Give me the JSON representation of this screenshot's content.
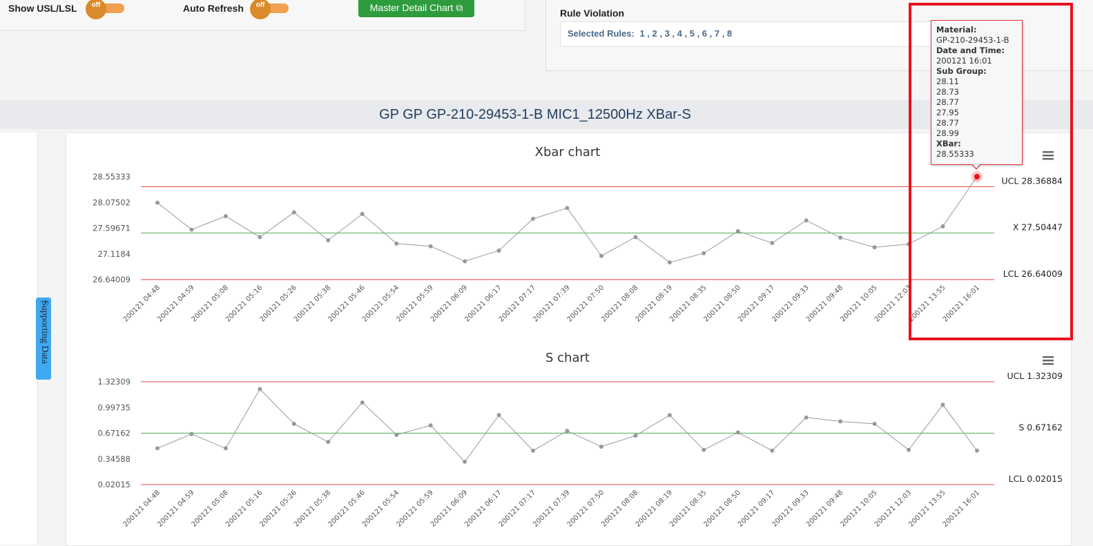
{
  "toolbar": {
    "show_usl_lsl_label": "Show USL/LSL",
    "show_usl_lsl_state": "off",
    "auto_refresh_label": "Auto Refresh",
    "auto_refresh_state": "off",
    "master_detail_label": "Master Detail Chart ⧉"
  },
  "rule_violation": {
    "label": "Rule Violation",
    "selected_prefix": "Selected Rules:",
    "selected_rules": "1 , 2 , 3 , 4 , 5 , 6 , 7 , 8"
  },
  "page_title": "GP GP GP-210-29453-1-B MIC1_12500Hz XBar-S",
  "support_tab_label": "Supporting Data",
  "tooltip": {
    "material_label": "Material:",
    "material_value": "GP-210-29453-1-B",
    "datetime_label": "Date and Time:",
    "datetime_value": "200121 16:01",
    "subgroup_label": "Sub Group:",
    "subgroup_values": [
      "28.11",
      "28.73",
      "28.77",
      "27.95",
      "28.77",
      "28.99"
    ],
    "xbar_label": "XBar:",
    "xbar_value": "28.55333"
  },
  "colors": {
    "limit_line": "#e84040",
    "center_line": "#4caf50",
    "series": "#999999",
    "highlight": "#e8121c"
  },
  "chart_data": [
    {
      "type": "line",
      "title": "Xbar chart",
      "categories": [
        "200121 04:48",
        "200121 04:59",
        "200121 05:08",
        "200121 05:16",
        "200121 05:26",
        "200121 05:38",
        "200121 05:46",
        "200121 05:54",
        "200121 05:59",
        "200121 06:09",
        "200121 06:17",
        "200121 07:17",
        "200121 07:39",
        "200121 07:50",
        "200121 08:08",
        "200121 08:19",
        "200121 08:35",
        "200121 08:50",
        "200121 09:17",
        "200121 09:33",
        "200121 09:48",
        "200121 10:05",
        "200121 12:03",
        "200121 13:55",
        "200121 16:01"
      ],
      "values": [
        28.07,
        27.57,
        27.82,
        27.43,
        27.89,
        27.37,
        27.86,
        27.31,
        27.26,
        26.98,
        27.18,
        27.77,
        27.97,
        27.08,
        27.43,
        26.96,
        27.13,
        27.54,
        27.32,
        27.74,
        27.42,
        27.24,
        27.3,
        27.63,
        28.55333
      ],
      "ylim": [
        26.64009,
        28.55333
      ],
      "yticks": [
        "28.55333",
        "28.07502",
        "27.59671",
        "27.1184",
        "26.64009"
      ],
      "lines": [
        {
          "label": "UCL 28.36884",
          "value": 28.36884,
          "kind": "limit"
        },
        {
          "label": "X 27.50447",
          "value": 27.50447,
          "kind": "center"
        },
        {
          "label": "LCL 26.64009",
          "value": 26.64009,
          "kind": "limit"
        }
      ],
      "highlight_index": 24
    },
    {
      "type": "line",
      "title": "S chart",
      "categories": [
        "200121 04:48",
        "200121 04:59",
        "200121 05:08",
        "200121 05:16",
        "200121 05:26",
        "200121 05:38",
        "200121 05:46",
        "200121 05:54",
        "200121 05:59",
        "200121 06:09",
        "200121 06:17",
        "200121 07:17",
        "200121 07:39",
        "200121 07:50",
        "200121 08:08",
        "200121 08:19",
        "200121 08:35",
        "200121 08:50",
        "200121 09:17",
        "200121 09:33",
        "200121 09:48",
        "200121 10:05",
        "200121 12:03",
        "200121 13:55",
        "200121 16:01"
      ],
      "values": [
        0.48,
        0.66,
        0.48,
        1.23,
        0.79,
        0.56,
        1.06,
        0.65,
        0.77,
        0.31,
        0.9,
        0.45,
        0.7,
        0.5,
        0.64,
        0.9,
        0.46,
        0.68,
        0.45,
        0.87,
        0.82,
        0.79,
        0.46,
        1.03,
        0.45
      ],
      "ylim": [
        0.02015,
        1.32309
      ],
      "yticks": [
        "1.32309",
        "0.99735",
        "0.67162",
        "0.34588",
        "0.02015"
      ],
      "lines": [
        {
          "label": "UCL 1.32309",
          "value": 1.32309,
          "kind": "limit"
        },
        {
          "label": "S 0.67162",
          "value": 0.67162,
          "kind": "center"
        },
        {
          "label": "LCL 0.02015",
          "value": 0.02015,
          "kind": "limit"
        }
      ],
      "highlight_index": -1
    }
  ]
}
